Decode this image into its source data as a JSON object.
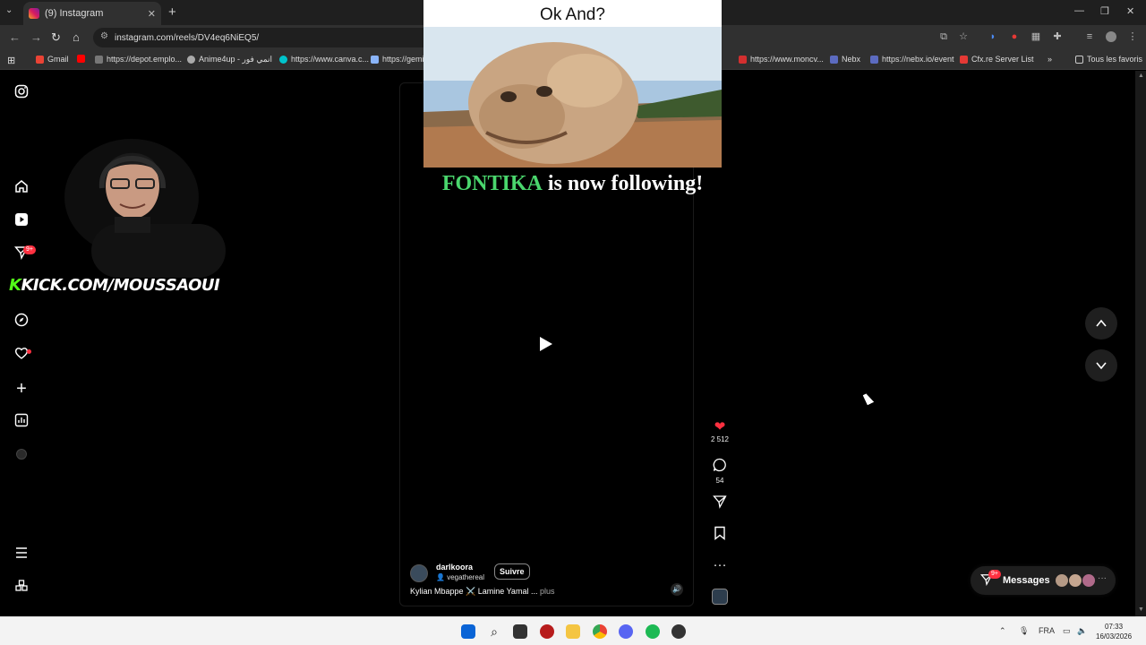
{
  "browser": {
    "tab_title": "(9) Instagram",
    "url": "instagram.com/reels/DV4eq6NiEQ5/",
    "bookmarks": [
      {
        "label": "Gmail",
        "color": "#ea4335"
      },
      {
        "label": "",
        "color": "#ff0000"
      },
      {
        "label": "https://depot.emplo...",
        "color": "#777777"
      },
      {
        "label": "Anime4up - انمي فور",
        "color": "#aaaaaa"
      },
      {
        "label": "https://www.canva.c...",
        "color": "#00c4cc"
      },
      {
        "label": "https://gemi",
        "color": "#8ab4f8"
      },
      {
        "label": "https://www.moncv...",
        "color": "#d32f2f"
      },
      {
        "label": "Nebx",
        "color": "#5c6bc0"
      },
      {
        "label": "https://nebx.io/event",
        "color": "#5c6bc0"
      },
      {
        "label": "Cfx.re Server List",
        "color": "#e53935"
      }
    ],
    "all_bookmarks": "Tous les favoris"
  },
  "overlay": {
    "title": "Ok And?",
    "follower_name": "FONTIKA",
    "follow_text": "is now following!",
    "kick_k": "K",
    "kick_text": "KICK.COM/MOUSSAOUI"
  },
  "sidebar": {
    "notification_badge": "9+"
  },
  "reel": {
    "likes": "2 512",
    "comments": "54",
    "username": "darlkoora",
    "audio_user": "vegathereal",
    "follow_button": "Suivre",
    "caption": "Kylian Mbappe ⚔️ Lamine Yamal ...",
    "more": "plus"
  },
  "messages": {
    "label": "Messages",
    "badge": "9+"
  },
  "taskbar": {
    "lang": "FRA",
    "time": "07:33",
    "date": "16/03/2026"
  }
}
